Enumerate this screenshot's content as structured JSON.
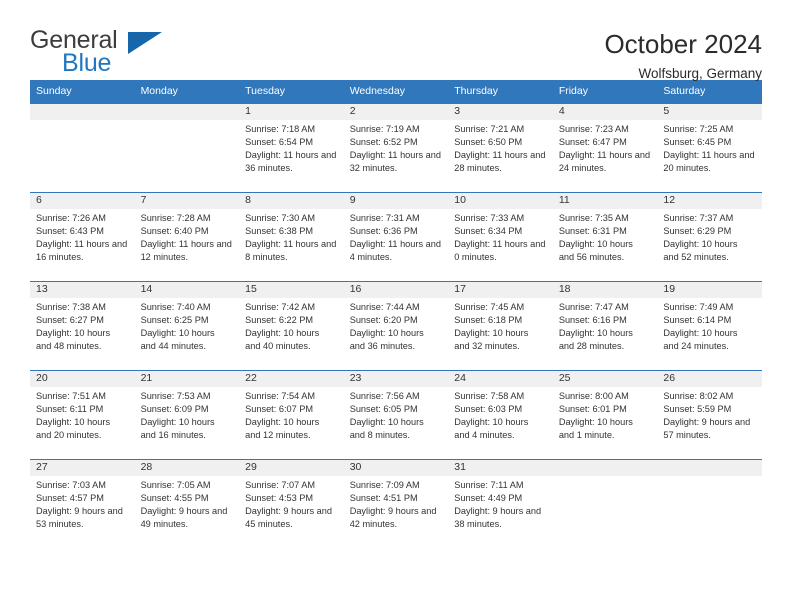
{
  "brand": {
    "name_part1": "General",
    "name_part2": "Blue",
    "triangle_color": "#1566ab",
    "blue_color": "#1f77c2"
  },
  "header": {
    "title": "October 2024",
    "subtitle": "Wolfsburg, Germany",
    "accent_color": "#3077bc"
  },
  "weekday_headers": [
    "Sunday",
    "Monday",
    "Tuesday",
    "Wednesday",
    "Thursday",
    "Friday",
    "Saturday"
  ],
  "labels": {
    "sunrise_prefix": "Sunrise:",
    "sunset_prefix": "Sunset:",
    "daylight_prefix": "Daylight:"
  },
  "weeks": [
    [
      {
        "empty": true
      },
      {
        "empty": true
      },
      {
        "day": "1",
        "sunrise": "Sunrise: 7:18 AM",
        "sunset": "Sunset: 6:54 PM",
        "daylight": "Daylight: 11 hours and 36 minutes."
      },
      {
        "day": "2",
        "sunrise": "Sunrise: 7:19 AM",
        "sunset": "Sunset: 6:52 PM",
        "daylight": "Daylight: 11 hours and 32 minutes."
      },
      {
        "day": "3",
        "sunrise": "Sunrise: 7:21 AM",
        "sunset": "Sunset: 6:50 PM",
        "daylight": "Daylight: 11 hours and 28 minutes."
      },
      {
        "day": "4",
        "sunrise": "Sunrise: 7:23 AM",
        "sunset": "Sunset: 6:47 PM",
        "daylight": "Daylight: 11 hours and 24 minutes."
      },
      {
        "day": "5",
        "sunrise": "Sunrise: 7:25 AM",
        "sunset": "Sunset: 6:45 PM",
        "daylight": "Daylight: 11 hours and 20 minutes."
      }
    ],
    [
      {
        "day": "6",
        "sunrise": "Sunrise: 7:26 AM",
        "sunset": "Sunset: 6:43 PM",
        "daylight": "Daylight: 11 hours and 16 minutes."
      },
      {
        "day": "7",
        "sunrise": "Sunrise: 7:28 AM",
        "sunset": "Sunset: 6:40 PM",
        "daylight": "Daylight: 11 hours and 12 minutes."
      },
      {
        "day": "8",
        "sunrise": "Sunrise: 7:30 AM",
        "sunset": "Sunset: 6:38 PM",
        "daylight": "Daylight: 11 hours and 8 minutes."
      },
      {
        "day": "9",
        "sunrise": "Sunrise: 7:31 AM",
        "sunset": "Sunset: 6:36 PM",
        "daylight": "Daylight: 11 hours and 4 minutes."
      },
      {
        "day": "10",
        "sunrise": "Sunrise: 7:33 AM",
        "sunset": "Sunset: 6:34 PM",
        "daylight": "Daylight: 11 hours and 0 minutes."
      },
      {
        "day": "11",
        "sunrise": "Sunrise: 7:35 AM",
        "sunset": "Sunset: 6:31 PM",
        "daylight": "Daylight: 10 hours and 56 minutes."
      },
      {
        "day": "12",
        "sunrise": "Sunrise: 7:37 AM",
        "sunset": "Sunset: 6:29 PM",
        "daylight": "Daylight: 10 hours and 52 minutes."
      }
    ],
    [
      {
        "day": "13",
        "sunrise": "Sunrise: 7:38 AM",
        "sunset": "Sunset: 6:27 PM",
        "daylight": "Daylight: 10 hours and 48 minutes."
      },
      {
        "day": "14",
        "sunrise": "Sunrise: 7:40 AM",
        "sunset": "Sunset: 6:25 PM",
        "daylight": "Daylight: 10 hours and 44 minutes."
      },
      {
        "day": "15",
        "sunrise": "Sunrise: 7:42 AM",
        "sunset": "Sunset: 6:22 PM",
        "daylight": "Daylight: 10 hours and 40 minutes."
      },
      {
        "day": "16",
        "sunrise": "Sunrise: 7:44 AM",
        "sunset": "Sunset: 6:20 PM",
        "daylight": "Daylight: 10 hours and 36 minutes."
      },
      {
        "day": "17",
        "sunrise": "Sunrise: 7:45 AM",
        "sunset": "Sunset: 6:18 PM",
        "daylight": "Daylight: 10 hours and 32 minutes."
      },
      {
        "day": "18",
        "sunrise": "Sunrise: 7:47 AM",
        "sunset": "Sunset: 6:16 PM",
        "daylight": "Daylight: 10 hours and 28 minutes."
      },
      {
        "day": "19",
        "sunrise": "Sunrise: 7:49 AM",
        "sunset": "Sunset: 6:14 PM",
        "daylight": "Daylight: 10 hours and 24 minutes."
      }
    ],
    [
      {
        "day": "20",
        "sunrise": "Sunrise: 7:51 AM",
        "sunset": "Sunset: 6:11 PM",
        "daylight": "Daylight: 10 hours and 20 minutes."
      },
      {
        "day": "21",
        "sunrise": "Sunrise: 7:53 AM",
        "sunset": "Sunset: 6:09 PM",
        "daylight": "Daylight: 10 hours and 16 minutes."
      },
      {
        "day": "22",
        "sunrise": "Sunrise: 7:54 AM",
        "sunset": "Sunset: 6:07 PM",
        "daylight": "Daylight: 10 hours and 12 minutes."
      },
      {
        "day": "23",
        "sunrise": "Sunrise: 7:56 AM",
        "sunset": "Sunset: 6:05 PM",
        "daylight": "Daylight: 10 hours and 8 minutes."
      },
      {
        "day": "24",
        "sunrise": "Sunrise: 7:58 AM",
        "sunset": "Sunset: 6:03 PM",
        "daylight": "Daylight: 10 hours and 4 minutes."
      },
      {
        "day": "25",
        "sunrise": "Sunrise: 8:00 AM",
        "sunset": "Sunset: 6:01 PM",
        "daylight": "Daylight: 10 hours and 1 minute."
      },
      {
        "day": "26",
        "sunrise": "Sunrise: 8:02 AM",
        "sunset": "Sunset: 5:59 PM",
        "daylight": "Daylight: 9 hours and 57 minutes."
      }
    ],
    [
      {
        "day": "27",
        "sunrise": "Sunrise: 7:03 AM",
        "sunset": "Sunset: 4:57 PM",
        "daylight": "Daylight: 9 hours and 53 minutes."
      },
      {
        "day": "28",
        "sunrise": "Sunrise: 7:05 AM",
        "sunset": "Sunset: 4:55 PM",
        "daylight": "Daylight: 9 hours and 49 minutes."
      },
      {
        "day": "29",
        "sunrise": "Sunrise: 7:07 AM",
        "sunset": "Sunset: 4:53 PM",
        "daylight": "Daylight: 9 hours and 45 minutes."
      },
      {
        "day": "30",
        "sunrise": "Sunrise: 7:09 AM",
        "sunset": "Sunset: 4:51 PM",
        "daylight": "Daylight: 9 hours and 42 minutes."
      },
      {
        "day": "31",
        "sunrise": "Sunrise: 7:11 AM",
        "sunset": "Sunset: 4:49 PM",
        "daylight": "Daylight: 9 hours and 38 minutes."
      },
      {
        "empty": true
      },
      {
        "empty": true
      }
    ]
  ]
}
